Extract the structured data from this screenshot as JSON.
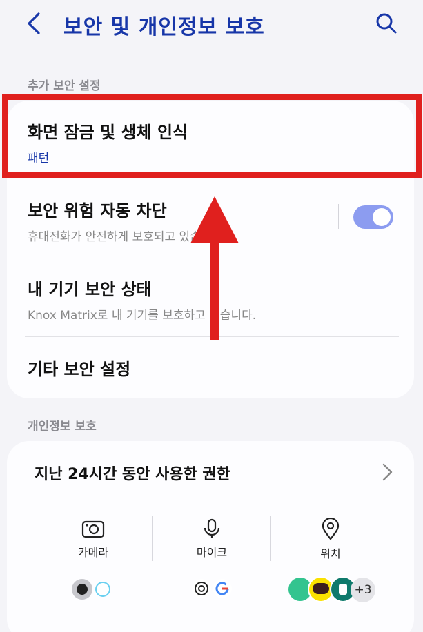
{
  "header": {
    "title": "보안 및 개인정보 보호",
    "back_icon": "chevron-left-icon",
    "search_icon": "search-icon"
  },
  "sections": {
    "extra_security": {
      "label": "추가 보안 설정",
      "items": [
        {
          "title": "화면 잠금 및 생체 인식",
          "subtitle": "패턴"
        },
        {
          "title": "보안 위험 자동 차단",
          "subtitle": "휴대전화가 안전하게 보호되고 있습니다.",
          "toggle_on": true
        },
        {
          "title": "내 기기 보안 상태",
          "subtitle": "Knox Matrix로 내 기기를 보호하고 있습니다."
        },
        {
          "title": "기타 보안 설정"
        }
      ]
    },
    "privacy": {
      "label": "개인정보 보호",
      "permissions_title": "지난 24시간 동안 사용한 권한",
      "permissions": [
        {
          "label": "카메라",
          "icon": "camera-icon"
        },
        {
          "label": "마이크",
          "icon": "microphone-icon"
        },
        {
          "label": "위치",
          "icon": "location-pin-icon"
        }
      ],
      "more_apps": "+3"
    }
  },
  "colors": {
    "accent": "#1736a8",
    "toggle": "#8c9cf0",
    "highlight": "#e0201e",
    "background": "#f4f4f8"
  }
}
